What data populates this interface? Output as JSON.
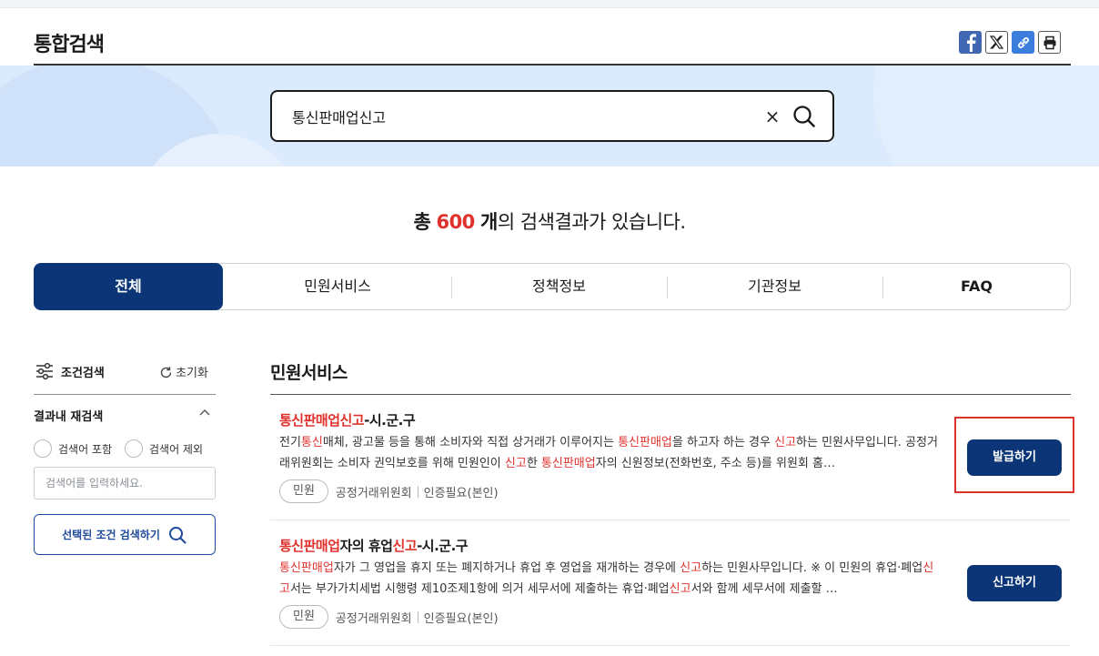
{
  "header": {
    "title": "통합검색",
    "share_icons": [
      "facebook-icon",
      "x-twitter-icon",
      "link-icon",
      "print-icon"
    ]
  },
  "search": {
    "value": "통신판매업신고",
    "clear_label": "×"
  },
  "summary": {
    "prefix": "총",
    "count": "600",
    "unit": "개",
    "suffix": "의 검색결과가 있습니다."
  },
  "tabs": [
    {
      "label": "전체",
      "active": true
    },
    {
      "label": "민원서비스",
      "active": false
    },
    {
      "label": "정책정보",
      "active": false
    },
    {
      "label": "기관정보",
      "active": false
    },
    {
      "label": "FAQ",
      "active": false
    }
  ],
  "filter": {
    "title": "조건검색",
    "reset_label": "초기화",
    "sub_title": "결과내 재검색",
    "include_label": "검색어 포함",
    "exclude_label": "검색어 제외",
    "input_placeholder": "검색어를 입력하세요.",
    "apply_label": "선택된 조건 검색하기"
  },
  "section": {
    "title": "민원서비스"
  },
  "results": [
    {
      "title": "통신판매업신고-시.군.구",
      "description": "전기통신매체, 광고물 등을 통해 소비자와 직접 상거래가 이루어지는 통신판매업을 하고자 하는 경우 신고하는 민원사무입니다. 공정거래위원회는 소비자 권익보호를 위해 민원인이 신고한 통신판매업자의 신원정보(전화번호, 주소 등)를 위원회 홈…",
      "badge": "민원",
      "agency": "공정거래위원회",
      "auth": "인증필요(본인)",
      "action_label": "발급하기"
    },
    {
      "title": "통신판매업자의 휴업신고-시.군.구",
      "description": "통신판매업자가 그 영업을 휴지 또는 폐지하거나 휴업 후 영업을 재개하는 경우에 신고하는 민원사무입니다. ※ 이 민원의 휴업·폐업신고서는 부가가치세법 시행령 제10조제1항에 의거 세무서에 제출하는 휴업·폐업신고서와 함께 세무서에 제출할 …",
      "badge": "민원",
      "agency": "공정거래위원회",
      "auth": "인증필요(본인)",
      "action_label": "신고하기"
    }
  ],
  "colors": {
    "primary": "#0b3576",
    "highlight": "#e0322d",
    "hero_bg": "#dbeafc"
  }
}
